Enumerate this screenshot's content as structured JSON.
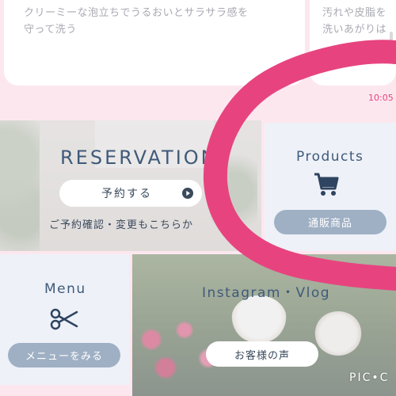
{
  "top_cards": [
    {
      "text_line1": "クリーミーな泡立ちでうるおいとサラサラ感を",
      "text_line2": "守って洗う"
    },
    {
      "text_line1": "汚れや皮脂を",
      "text_line2": "洗いあがりは"
    }
  ],
  "status_time": "10:05",
  "reservation": {
    "title": "RESERVATION",
    "button_label": "予約する",
    "subtext": "ご予約確認・変更もこちらか"
  },
  "products": {
    "title": "Products",
    "button_label": "通販商品",
    "icon": "cart-icon"
  },
  "menu": {
    "title": "Menu",
    "button_label": "メニューをみる",
    "icon": "scissors-icon"
  },
  "instagram": {
    "title": "Instagram・Vlog",
    "button_label": "お客様の声"
  },
  "watermark": "PIC•C",
  "colors": {
    "accent_pink": "#e7447f",
    "heading_navy": "#3f5a7a",
    "button_gray": "#9fb0c4",
    "background_pink": "#fde7ef"
  }
}
